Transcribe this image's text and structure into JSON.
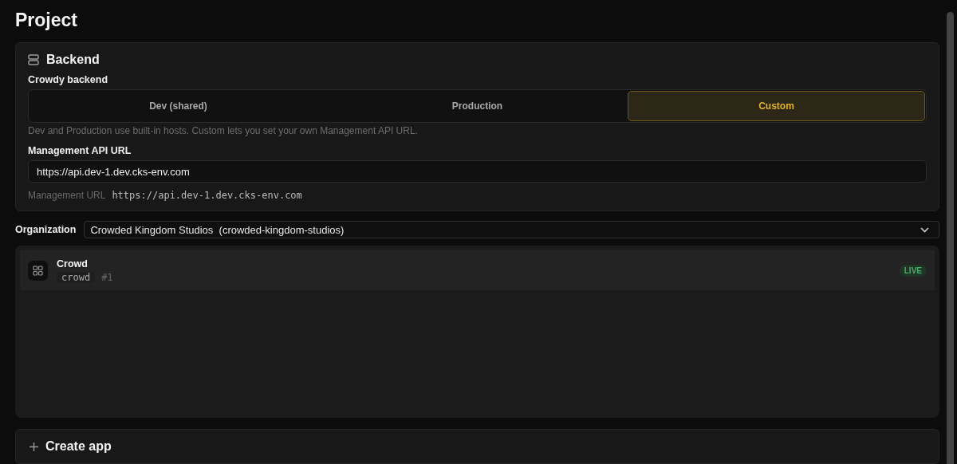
{
  "title": "Project",
  "backend": {
    "title": "Backend",
    "label": "Crowdy backend",
    "options": [
      {
        "label": "Dev (shared)",
        "selected": false
      },
      {
        "label": "Production",
        "selected": false
      },
      {
        "label": "Custom",
        "selected": true
      }
    ],
    "hint": "Dev and Production use built-in hosts. Custom lets you set your own Management API URL.",
    "url_label": "Management API URL",
    "url_value": "https://api.dev-1.dev.cks-env.com",
    "resolved_label": "Management URL",
    "resolved_value": "https://api.dev-1.dev.cks-env.com"
  },
  "organization": {
    "label": "Organization",
    "value": "Crowded Kingdom Studios  (crowded-kingdom-studios)"
  },
  "apps": [
    {
      "name": "Crowd",
      "slug": "crowd",
      "number": "#1",
      "status": "LIVE"
    }
  ],
  "create_app": {
    "title": "Create app"
  }
}
